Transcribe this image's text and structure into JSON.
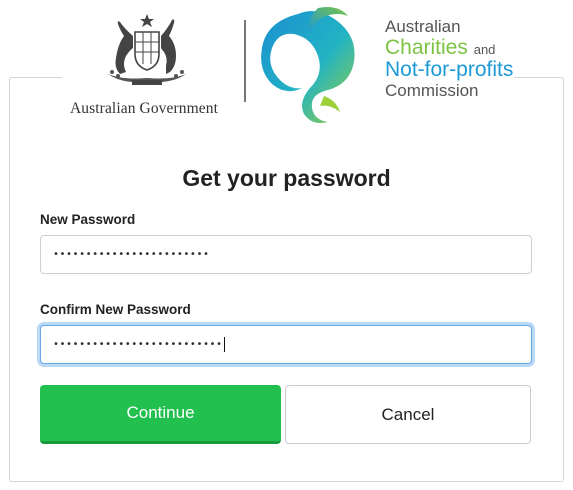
{
  "header": {
    "government_name": "Australian Government",
    "acnc": {
      "line1": "Australian",
      "line2": "Charities",
      "line2_suffix": "and",
      "line3": "Not-for-profits",
      "line4": "Commission"
    }
  },
  "form": {
    "title": "Get your password",
    "new_password": {
      "label": "New Password",
      "value": "••••••••••••••••••••••••"
    },
    "confirm_password": {
      "label": "Confirm New Password",
      "value": "••••••••••••••••••••••••••"
    },
    "continue_label": "Continue",
    "cancel_label": "Cancel"
  },
  "colors": {
    "continue_green": "#21c04f",
    "acnc_green": "#7cc443",
    "acnc_blue": "#1d9ad6",
    "focus_blue": "#6aa9e8"
  },
  "icons": [
    "coat-of-arms-icon",
    "acnc-logo-icon"
  ]
}
